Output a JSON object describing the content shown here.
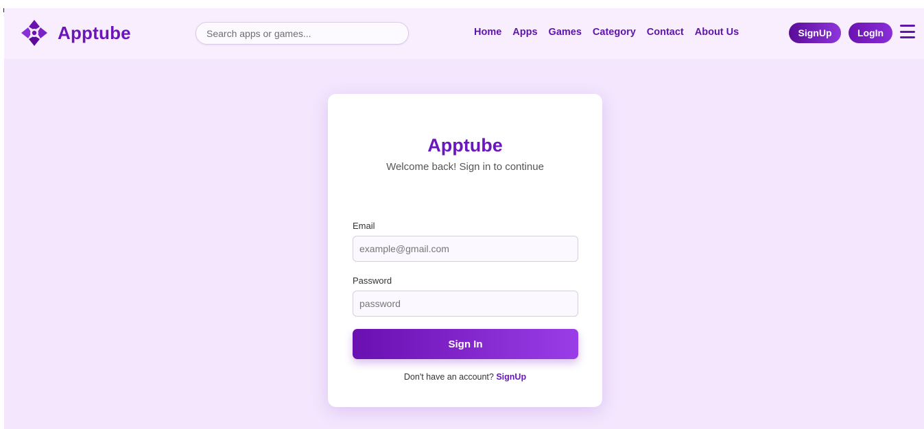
{
  "header": {
    "brand_name": "Apptube",
    "search_placeholder": "Search apps or games...",
    "nav": [
      "Home",
      "Apps",
      "Games",
      "Category",
      "Contact",
      "About Us"
    ],
    "signup_label": "SignUp",
    "login_label": "LogIn"
  },
  "login_card": {
    "title": "Apptube",
    "subtitle": "Welcome back! Sign in to continue",
    "email_label": "Email",
    "email_placeholder": "example@gmail.com",
    "password_label": "Password",
    "password_placeholder": "password",
    "submit_label": "Sign In",
    "no_account_text": "Don't have an account?",
    "signup_link": "SignUp"
  },
  "colors": {
    "brand_purple": "#6b17c0",
    "page_background": "#f3e6fd",
    "header_background": "#f8eefd"
  }
}
